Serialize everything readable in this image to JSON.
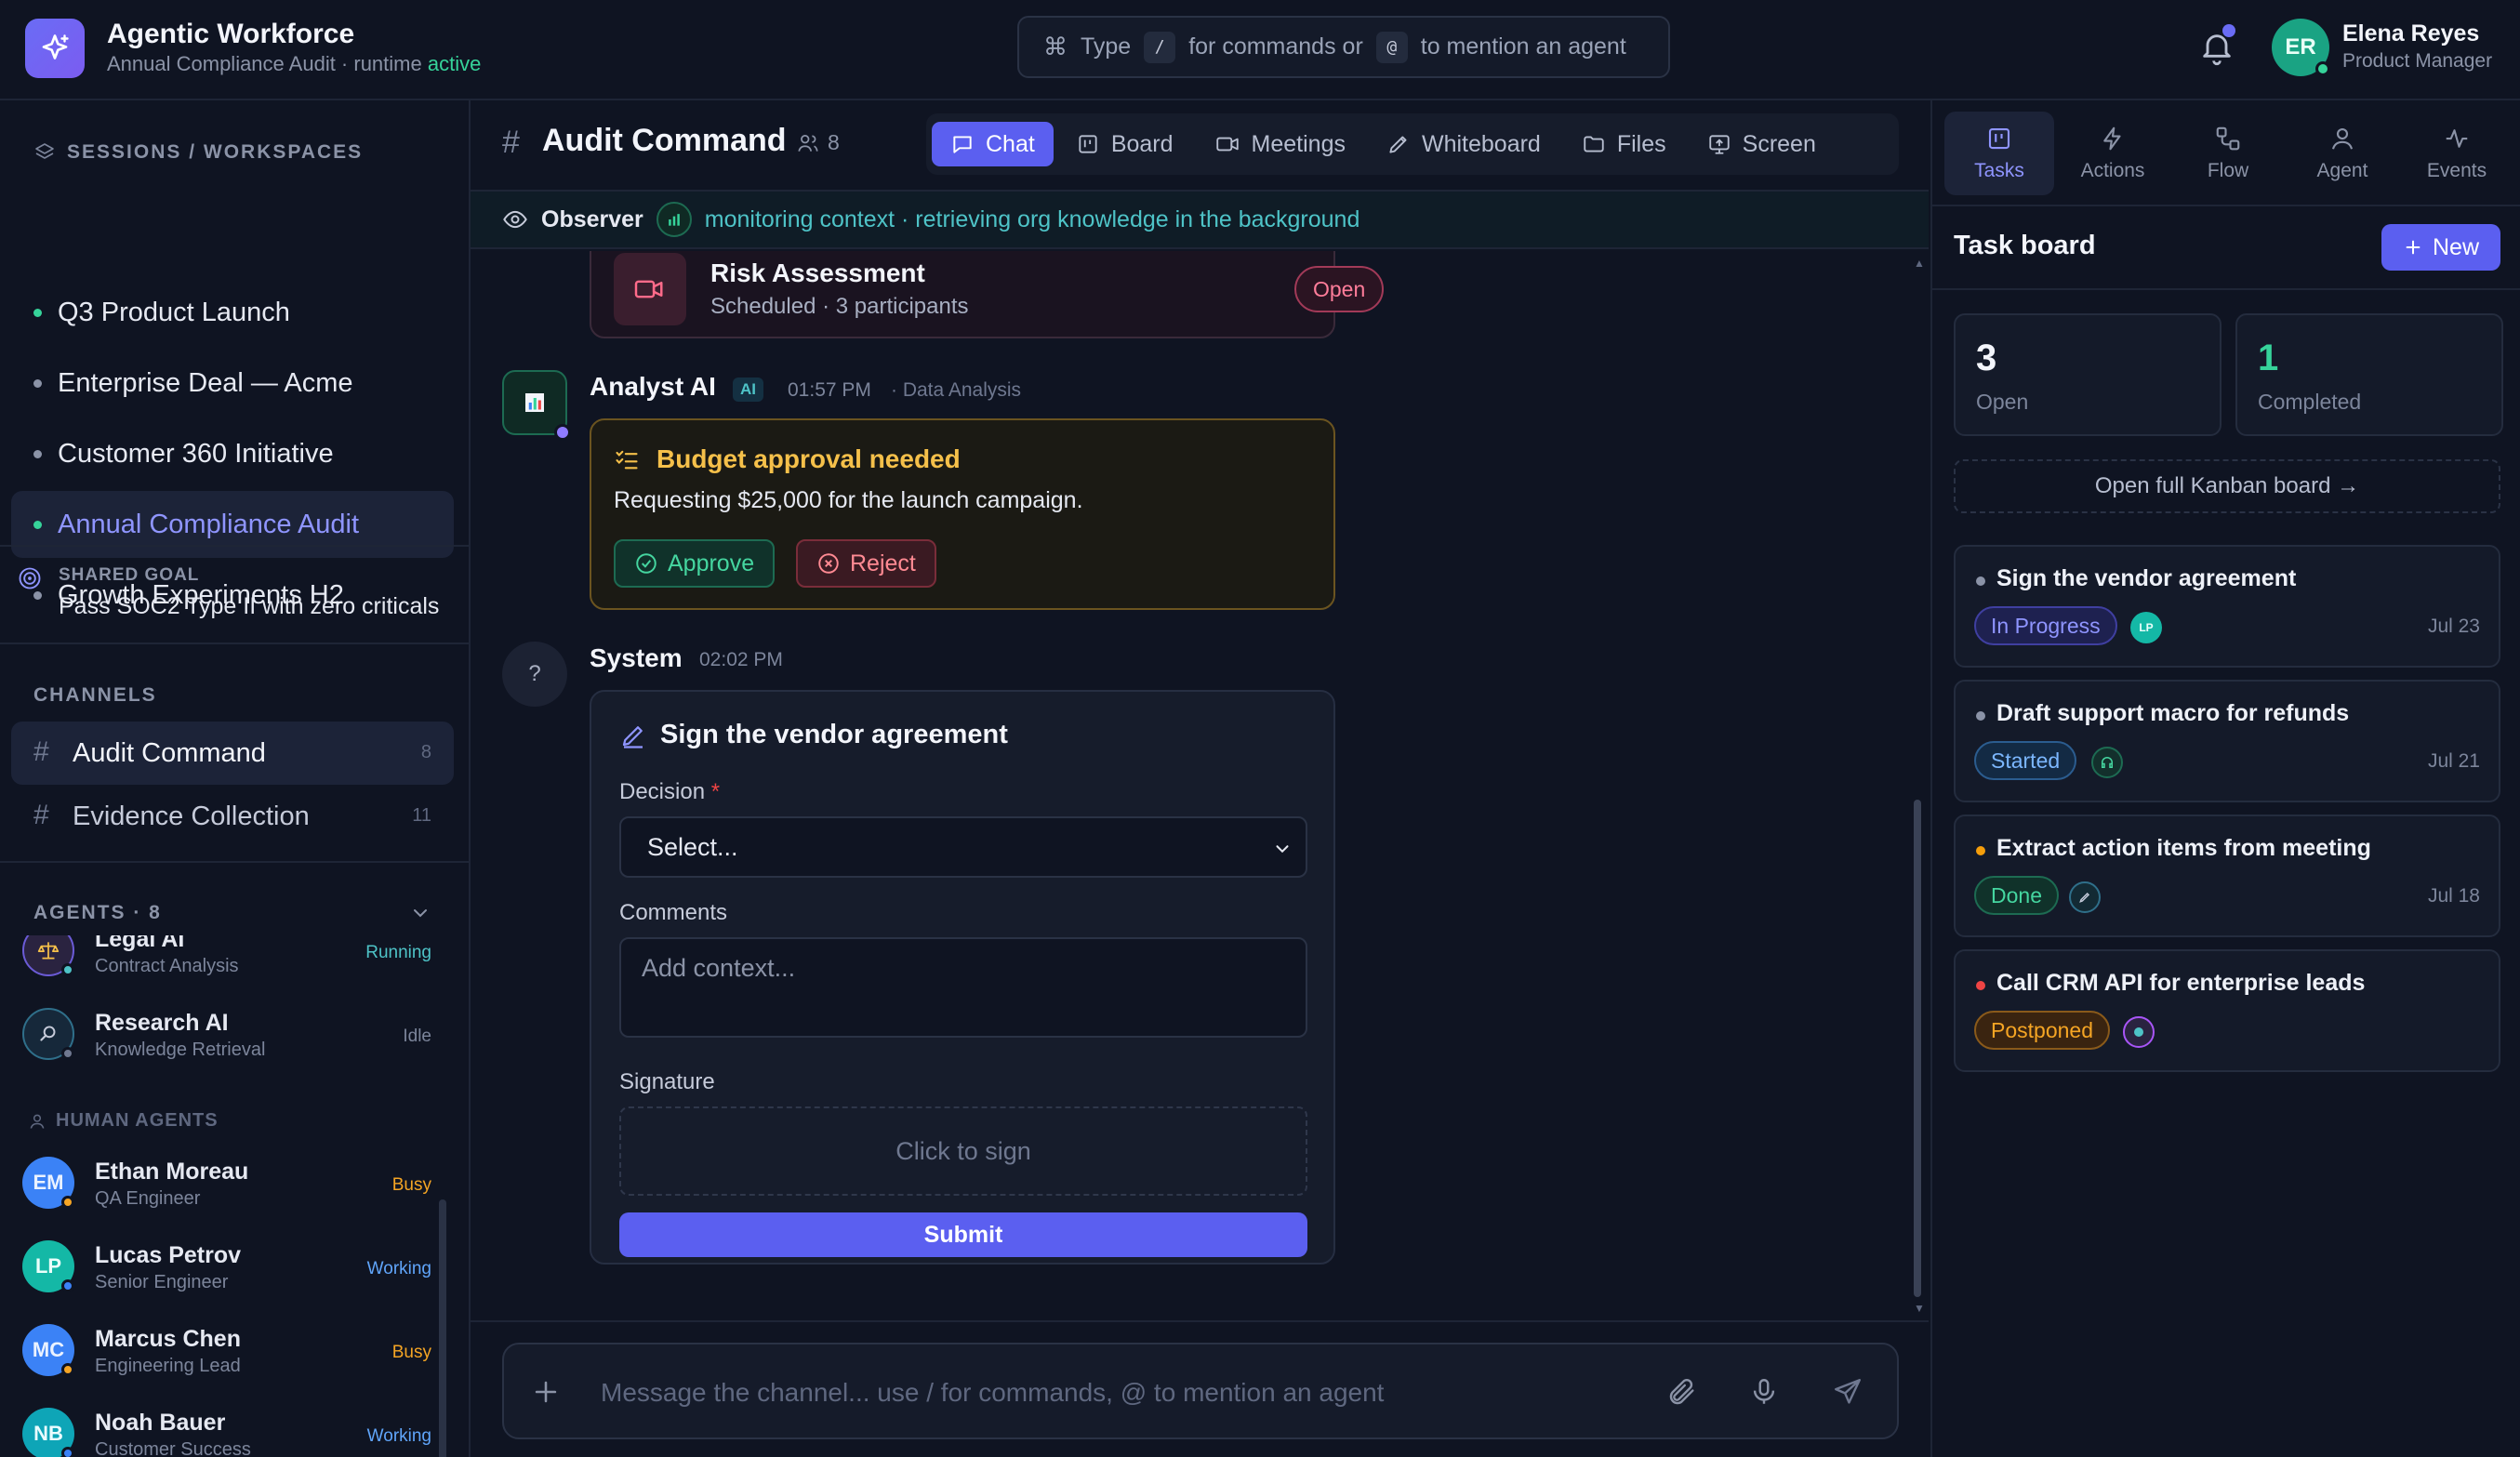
{
  "app": {
    "title": "Agentic Workforce",
    "subtitle_prefix": "Annual Compliance Audit · runtime ",
    "subtitle_status": "active"
  },
  "command_bar": {
    "type": "Type",
    "slash": "/",
    "for_commands": "for commands or",
    "at": "@",
    "mention": "to mention an agent"
  },
  "user": {
    "initials": "ER",
    "name": "Elena Reyes",
    "role": "Product Manager"
  },
  "sidebar": {
    "sessions_header": "SESSIONS / WORKSPACES",
    "workspaces": [
      {
        "label": "Q3 Product Launch",
        "state": "live"
      },
      {
        "label": "Enterprise Deal — Acme",
        "state": "idle"
      },
      {
        "label": "Customer 360 Initiative",
        "state": "idle"
      },
      {
        "label": "Annual Compliance Audit",
        "state": "active"
      },
      {
        "label": "Growth Experiments H2",
        "state": "idle"
      }
    ],
    "shared_goal_label": "SHARED GOAL",
    "shared_goal": "Pass SOC2 Type II with zero criticals",
    "channels_header": "CHANNELS",
    "channels": [
      {
        "label": "Audit Command",
        "count": "8"
      },
      {
        "label": "Evidence Collection",
        "count": "11"
      }
    ],
    "agents_header": "AGENTS · 8",
    "ai_agents": [
      {
        "name": "Legal AI",
        "role": "Contract Analysis",
        "status": "Running"
      },
      {
        "name": "Research AI",
        "role": "Knowledge Retrieval",
        "status": "Idle"
      }
    ],
    "human_agents_header": "HUMAN AGENTS",
    "human_agents": [
      {
        "initials": "EM",
        "name": "Ethan Moreau",
        "role": "QA Engineer",
        "status": "Busy"
      },
      {
        "initials": "LP",
        "name": "Lucas Petrov",
        "role": "Senior Engineer",
        "status": "Working"
      },
      {
        "initials": "MC",
        "name": "Marcus Chen",
        "role": "Engineering Lead",
        "status": "Busy"
      },
      {
        "initials": "NB",
        "name": "Noah Bauer",
        "role": "Customer Success",
        "status": "Working"
      }
    ]
  },
  "channel": {
    "hash": "#",
    "title": "Audit Command",
    "members": "8",
    "tabs": [
      "Chat",
      "Board",
      "Meetings",
      "Whiteboard",
      "Files",
      "Screen"
    ],
    "active_tab": "Chat",
    "observer_label": "Observer",
    "observer_text": "monitoring context · retrieving org knowledge in the background"
  },
  "messages": {
    "meeting": {
      "title": "Risk Assessment",
      "meta": "Scheduled · 3 participants",
      "action": "Open"
    },
    "analyst": {
      "author": "Analyst AI",
      "badge": "AI",
      "time": "01:57 PM",
      "tag": "· Data Analysis",
      "card_title": "Budget approval needed",
      "card_body": "Requesting $25,000 for the launch campaign.",
      "approve": "Approve",
      "reject": "Reject"
    },
    "system": {
      "author": "System",
      "avatar": "?",
      "time": "02:02 PM",
      "form_title": "Sign the vendor agreement",
      "decision_label": "Decision",
      "required_mark": "*",
      "decision_value": "Select...",
      "comments_label": "Comments",
      "comments_placeholder": "Add context...",
      "signature_label": "Signature",
      "signature_placeholder": "Click to sign",
      "submit": "Submit"
    }
  },
  "composer": {
    "placeholder": "Message the channel... use / for commands, @ to mention an agent"
  },
  "right_panel": {
    "tabs": [
      "Tasks",
      "Actions",
      "Flow",
      "Agent",
      "Events"
    ],
    "active_tab": "Tasks",
    "title": "Task board",
    "new_button": "New",
    "stats": [
      {
        "value": "3",
        "label": "Open"
      },
      {
        "value": "1",
        "label": "Completed"
      }
    ],
    "kanban_link": "Open full Kanban board →",
    "tasks": [
      {
        "title": "Sign the vendor agreement",
        "status": "In Progress",
        "assignee": "LP",
        "date": "Jul 23",
        "dot": "#8b93a7"
      },
      {
        "title": "Draft support macro for refunds",
        "status": "Started",
        "assignee": "headset-icon",
        "date": "Jul 21",
        "dot": "#8b93a7"
      },
      {
        "title": "Extract action items from meeting",
        "status": "Done",
        "assignee": "pen-icon",
        "date": "Jul 18",
        "dot": "#f59e0b"
      },
      {
        "title": "Call CRM API for enterprise leads",
        "status": "Postponed",
        "assignee": "agent-icon",
        "date": "",
        "dot": "#ef4444"
      }
    ]
  },
  "colors": {
    "accent": "#5b5ff0",
    "success": "#36d39a",
    "warning": "#f5a524",
    "danger": "#ef4444"
  }
}
